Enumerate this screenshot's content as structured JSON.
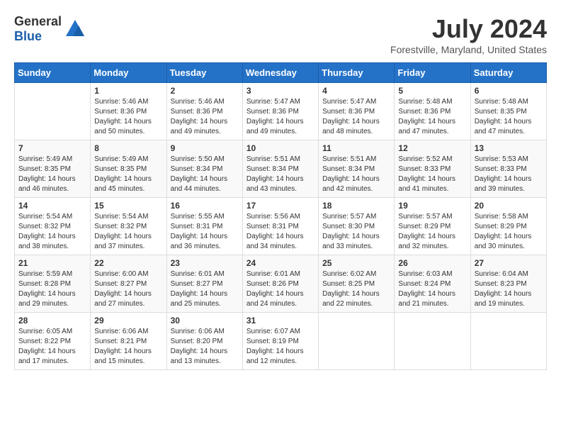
{
  "header": {
    "logo_general": "General",
    "logo_blue": "Blue",
    "month_year": "July 2024",
    "location": "Forestville, Maryland, United States"
  },
  "days_of_week": [
    "Sunday",
    "Monday",
    "Tuesday",
    "Wednesday",
    "Thursday",
    "Friday",
    "Saturday"
  ],
  "weeks": [
    [
      {
        "day": "",
        "info": ""
      },
      {
        "day": "1",
        "info": "Sunrise: 5:46 AM\nSunset: 8:36 PM\nDaylight: 14 hours and 50 minutes."
      },
      {
        "day": "2",
        "info": "Sunrise: 5:46 AM\nSunset: 8:36 PM\nDaylight: 14 hours and 49 minutes."
      },
      {
        "day": "3",
        "info": "Sunrise: 5:47 AM\nSunset: 8:36 PM\nDaylight: 14 hours and 49 minutes."
      },
      {
        "day": "4",
        "info": "Sunrise: 5:47 AM\nSunset: 8:36 PM\nDaylight: 14 hours and 48 minutes."
      },
      {
        "day": "5",
        "info": "Sunrise: 5:48 AM\nSunset: 8:36 PM\nDaylight: 14 hours and 47 minutes."
      },
      {
        "day": "6",
        "info": "Sunrise: 5:48 AM\nSunset: 8:35 PM\nDaylight: 14 hours and 47 minutes."
      }
    ],
    [
      {
        "day": "7",
        "info": "Sunrise: 5:49 AM\nSunset: 8:35 PM\nDaylight: 14 hours and 46 minutes."
      },
      {
        "day": "8",
        "info": "Sunrise: 5:49 AM\nSunset: 8:35 PM\nDaylight: 14 hours and 45 minutes."
      },
      {
        "day": "9",
        "info": "Sunrise: 5:50 AM\nSunset: 8:34 PM\nDaylight: 14 hours and 44 minutes."
      },
      {
        "day": "10",
        "info": "Sunrise: 5:51 AM\nSunset: 8:34 PM\nDaylight: 14 hours and 43 minutes."
      },
      {
        "day": "11",
        "info": "Sunrise: 5:51 AM\nSunset: 8:34 PM\nDaylight: 14 hours and 42 minutes."
      },
      {
        "day": "12",
        "info": "Sunrise: 5:52 AM\nSunset: 8:33 PM\nDaylight: 14 hours and 41 minutes."
      },
      {
        "day": "13",
        "info": "Sunrise: 5:53 AM\nSunset: 8:33 PM\nDaylight: 14 hours and 39 minutes."
      }
    ],
    [
      {
        "day": "14",
        "info": "Sunrise: 5:54 AM\nSunset: 8:32 PM\nDaylight: 14 hours and 38 minutes."
      },
      {
        "day": "15",
        "info": "Sunrise: 5:54 AM\nSunset: 8:32 PM\nDaylight: 14 hours and 37 minutes."
      },
      {
        "day": "16",
        "info": "Sunrise: 5:55 AM\nSunset: 8:31 PM\nDaylight: 14 hours and 36 minutes."
      },
      {
        "day": "17",
        "info": "Sunrise: 5:56 AM\nSunset: 8:31 PM\nDaylight: 14 hours and 34 minutes."
      },
      {
        "day": "18",
        "info": "Sunrise: 5:57 AM\nSunset: 8:30 PM\nDaylight: 14 hours and 33 minutes."
      },
      {
        "day": "19",
        "info": "Sunrise: 5:57 AM\nSunset: 8:29 PM\nDaylight: 14 hours and 32 minutes."
      },
      {
        "day": "20",
        "info": "Sunrise: 5:58 AM\nSunset: 8:29 PM\nDaylight: 14 hours and 30 minutes."
      }
    ],
    [
      {
        "day": "21",
        "info": "Sunrise: 5:59 AM\nSunset: 8:28 PM\nDaylight: 14 hours and 29 minutes."
      },
      {
        "day": "22",
        "info": "Sunrise: 6:00 AM\nSunset: 8:27 PM\nDaylight: 14 hours and 27 minutes."
      },
      {
        "day": "23",
        "info": "Sunrise: 6:01 AM\nSunset: 8:27 PM\nDaylight: 14 hours and 25 minutes."
      },
      {
        "day": "24",
        "info": "Sunrise: 6:01 AM\nSunset: 8:26 PM\nDaylight: 14 hours and 24 minutes."
      },
      {
        "day": "25",
        "info": "Sunrise: 6:02 AM\nSunset: 8:25 PM\nDaylight: 14 hours and 22 minutes."
      },
      {
        "day": "26",
        "info": "Sunrise: 6:03 AM\nSunset: 8:24 PM\nDaylight: 14 hours and 21 minutes."
      },
      {
        "day": "27",
        "info": "Sunrise: 6:04 AM\nSunset: 8:23 PM\nDaylight: 14 hours and 19 minutes."
      }
    ],
    [
      {
        "day": "28",
        "info": "Sunrise: 6:05 AM\nSunset: 8:22 PM\nDaylight: 14 hours and 17 minutes."
      },
      {
        "day": "29",
        "info": "Sunrise: 6:06 AM\nSunset: 8:21 PM\nDaylight: 14 hours and 15 minutes."
      },
      {
        "day": "30",
        "info": "Sunrise: 6:06 AM\nSunset: 8:20 PM\nDaylight: 14 hours and 13 minutes."
      },
      {
        "day": "31",
        "info": "Sunrise: 6:07 AM\nSunset: 8:19 PM\nDaylight: 14 hours and 12 minutes."
      },
      {
        "day": "",
        "info": ""
      },
      {
        "day": "",
        "info": ""
      },
      {
        "day": "",
        "info": ""
      }
    ]
  ]
}
